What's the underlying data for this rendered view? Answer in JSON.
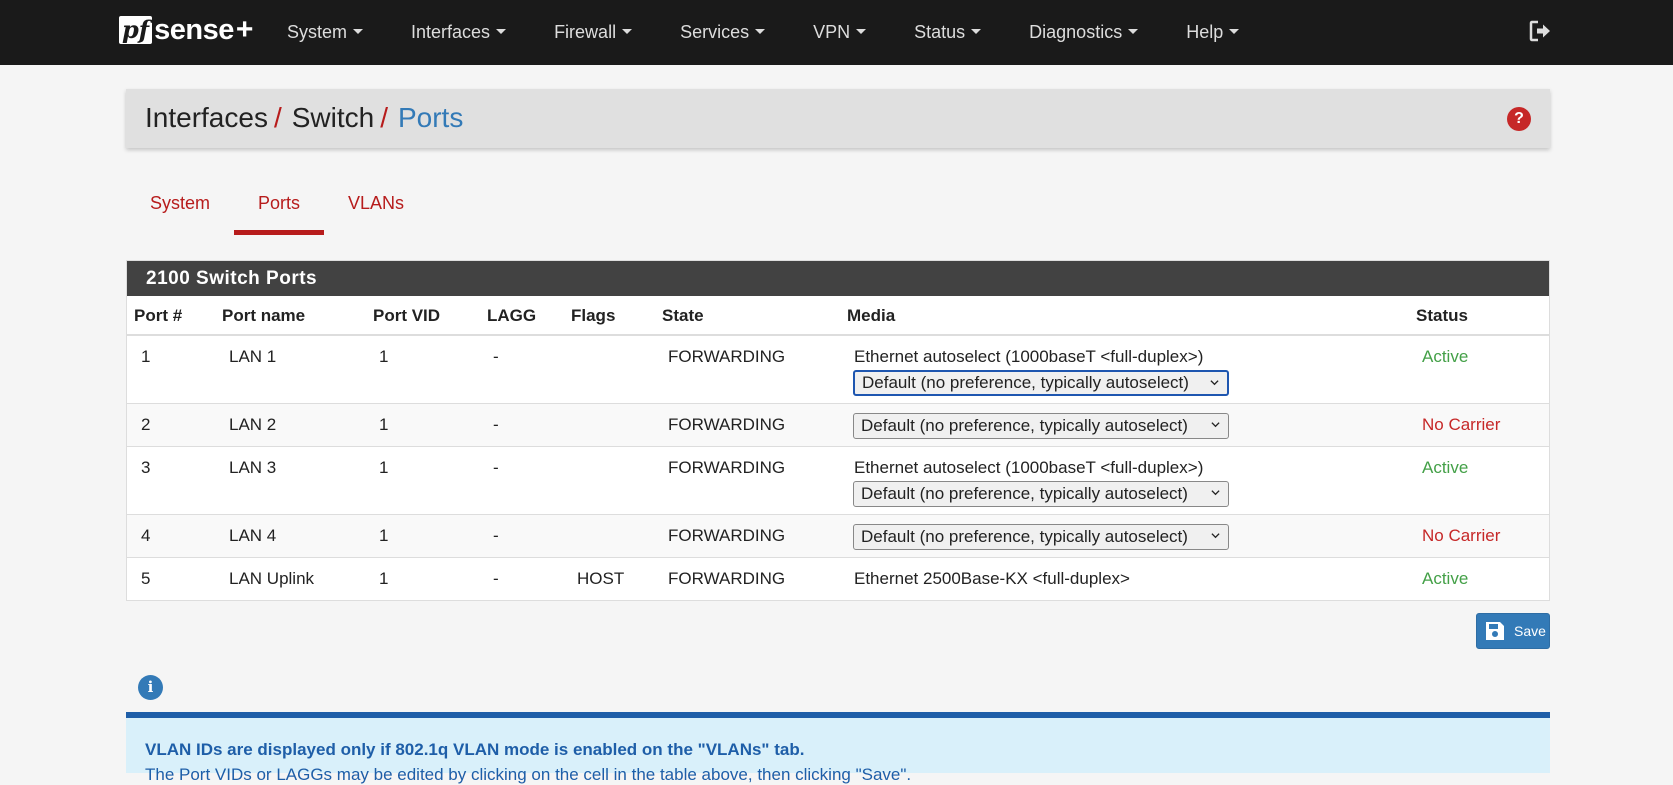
{
  "navbar": {
    "logo": {
      "pf": "pf",
      "sense": "sense",
      "plus": "+"
    },
    "items": [
      {
        "label": "System"
      },
      {
        "label": "Interfaces"
      },
      {
        "label": "Firewall"
      },
      {
        "label": "Services"
      },
      {
        "label": "VPN"
      },
      {
        "label": "Status"
      },
      {
        "label": "Diagnostics"
      },
      {
        "label": "Help"
      }
    ],
    "logout_icon": "sign-out-icon"
  },
  "breadcrumb": {
    "parts": [
      "Interfaces",
      "Switch"
    ],
    "current": "Ports",
    "separator": "/",
    "help_icon": "question-icon"
  },
  "tabs": [
    {
      "label": "System",
      "active": false
    },
    {
      "label": "Ports",
      "active": true
    },
    {
      "label": "VLANs",
      "active": false
    }
  ],
  "panel": {
    "title": "2100 Switch Ports",
    "columns": {
      "port_num": "Port #",
      "port_name": "Port name",
      "port_vid": "Port VID",
      "lagg": "LAGG",
      "flags": "Flags",
      "state": "State",
      "media": "Media",
      "status": "Status"
    },
    "rows": [
      {
        "port": "1",
        "name": "LAN 1",
        "vid": "1",
        "lagg": "-",
        "flags": "",
        "state": "FORWARDING",
        "media_text": "Ethernet autoselect (1000baseT <full-duplex>)",
        "media_select": "Default (no preference, typically autoselect)",
        "status": "Active"
      },
      {
        "port": "2",
        "name": "LAN 2",
        "vid": "1",
        "lagg": "-",
        "flags": "",
        "state": "FORWARDING",
        "media_text": "",
        "media_select": "Default (no preference, typically autoselect)",
        "status": "No Carrier"
      },
      {
        "port": "3",
        "name": "LAN 3",
        "vid": "1",
        "lagg": "-",
        "flags": "",
        "state": "FORWARDING",
        "media_text": "Ethernet autoselect (1000baseT <full-duplex>)",
        "media_select": "Default (no preference, typically autoselect)",
        "status": "Active"
      },
      {
        "port": "4",
        "name": "LAN 4",
        "vid": "1",
        "lagg": "-",
        "flags": "",
        "state": "FORWARDING",
        "media_text": "",
        "media_select": "Default (no preference, typically autoselect)",
        "status": "No Carrier"
      },
      {
        "port": "5",
        "name": "LAN Uplink",
        "vid": "1",
        "lagg": "-",
        "flags": "HOST",
        "state": "FORWARDING",
        "media_text": "Ethernet 2500Base-KX <full-duplex>",
        "media_select": "",
        "status": "Active"
      }
    ]
  },
  "save_button": {
    "label": "Save",
    "icon": "floppy-disk-icon"
  },
  "info": {
    "icon": "info-icon",
    "line1": "VLAN IDs are displayed only if 802.1q VLAN mode is enabled on the \"VLANs\" tab.",
    "line2": "The Port VIDs or LAGGs may be edited by clicking on the cell in the table above, then clicking \"Save\"."
  },
  "colors": {
    "navbar": "#1a1a1a",
    "accent_red": "#b71c1c",
    "link_blue": "#337ab7",
    "active_green": "#43a047",
    "info_bg": "#d9f0fa"
  }
}
